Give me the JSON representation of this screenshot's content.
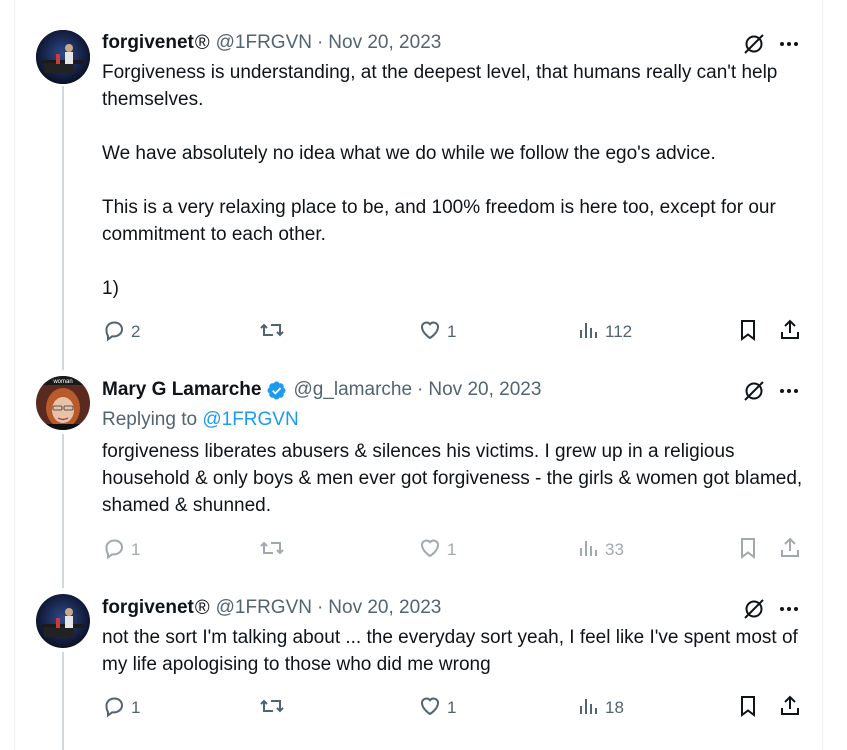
{
  "tweets": [
    {
      "author": {
        "name": "forgivenet",
        "suffix": "®",
        "handle": "@1FRGVN",
        "verified": false
      },
      "date": "Nov 20, 2023",
      "paragraphs": [
        "Forgiveness is understanding, at the deepest level, that humans really can't help themselves.",
        "We have absolutely no idea what we do while we follow the ego's advice.",
        "This is a very relaxing place to be, and 100% freedom is here too, except for our commitment to each other.",
        "1)"
      ],
      "stats": {
        "replies": "2",
        "retweets": "",
        "likes": "1",
        "views": "112"
      }
    },
    {
      "author": {
        "name": "Mary G Lamarche",
        "suffix": "",
        "handle": "@g_lamarche",
        "verified": true
      },
      "date": "Nov 20, 2023",
      "replying_to_label": "Replying to",
      "replying_to_handle": "@1FRGVN",
      "avatar_caption": "woman",
      "paragraphs": [
        "forgiveness liberates abusers &  silences his victims. I grew up in a religious household & only boys & men ever got forgiveness - the girls & women got blamed, shamed & shunned."
      ],
      "stats": {
        "replies": "1",
        "retweets": "",
        "likes": "1",
        "views": "33"
      }
    },
    {
      "author": {
        "name": "forgivenet",
        "suffix": "®",
        "handle": "@1FRGVN",
        "verified": false
      },
      "date": "Nov 20, 2023",
      "paragraphs": [
        "not the sort I'm talking about ... the everyday sort yeah, I feel like I've spent most of my life apologising to those who did me wrong"
      ],
      "stats": {
        "replies": "1",
        "retweets": "",
        "likes": "1",
        "views": "18"
      }
    }
  ],
  "colors": {
    "text": "#0f1419",
    "secondary": "#536471",
    "accent": "#1d9bf0",
    "thread_line": "#cfd9de",
    "border": "#eff3f4"
  },
  "icons": [
    "grok-icon",
    "more-icon",
    "reply-icon",
    "retweet-icon",
    "like-icon",
    "views-icon",
    "bookmark-icon",
    "share-icon",
    "verified-badge-icon"
  ]
}
